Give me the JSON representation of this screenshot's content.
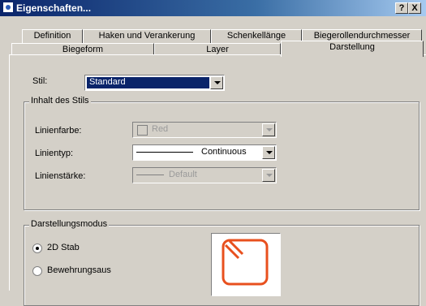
{
  "window": {
    "title": "Eigenschaften...",
    "help_label": "?",
    "close_label": "X"
  },
  "tabs_row1": [
    "Definition",
    "Haken und Verankerung",
    "Schenkellänge",
    "Biegerollendurchmesser"
  ],
  "tabs_row2": [
    "Biegeform",
    "Layer",
    "Darstellung"
  ],
  "active_tab": "Darstellung",
  "style": {
    "label": "Stil:",
    "value": "Standard"
  },
  "style_content": {
    "title": "Inhalt des Stils",
    "line_color": {
      "label": "Linienfarbe:",
      "value": "Red",
      "swatch_color": "#d4d0c8"
    },
    "line_type": {
      "label": "Linientyp:",
      "value": "Continuous"
    },
    "line_weight": {
      "label": "Linienstärke:",
      "value": "Default"
    }
  },
  "display_mode": {
    "title": "Darstellungsmodus",
    "options": [
      {
        "label": "2D Stab",
        "checked": true
      },
      {
        "label": "Bewehrungsaus",
        "checked": false
      }
    ],
    "preview_color": "#e8501e"
  },
  "colors": {
    "selection": "#0a246a",
    "disabled_text": "#9a9a9a"
  }
}
